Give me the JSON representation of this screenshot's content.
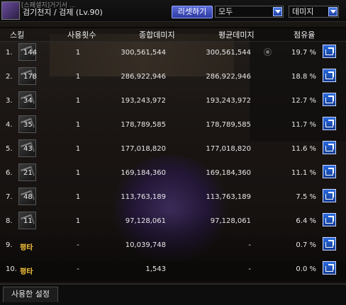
{
  "window": {
    "avatar_label": "[스페셜지]거기서 ...",
    "title": "검기천지 / 검제 (Lv.90)",
    "reset_button": "리셋하기",
    "filter_select": "모두",
    "type_select": "데미지"
  },
  "columns": {
    "skill": "스킬",
    "uses": "사용횟수",
    "total": "종합데미지",
    "average": "평균데미지",
    "share": "점유율"
  },
  "rows": [
    {
      "num": "1.",
      "id": "144",
      "uses": "1",
      "total": "300,561,544",
      "avg": "300,561,544",
      "share": "19.7 %",
      "special": false
    },
    {
      "num": "2.",
      "id": "178",
      "uses": "1",
      "total": "286,922,946",
      "avg": "286,922,946",
      "share": "18.8 %",
      "special": false
    },
    {
      "num": "3.",
      "id": "34",
      "uses": "1",
      "total": "193,243,972",
      "avg": "193,243,972",
      "share": "12.7 %",
      "special": false
    },
    {
      "num": "4.",
      "id": "35",
      "uses": "1",
      "total": "178,789,585",
      "avg": "178,789,585",
      "share": "11.7 %",
      "special": false
    },
    {
      "num": "5.",
      "id": "43",
      "uses": "1",
      "total": "177,018,820",
      "avg": "177,018,820",
      "share": "11.6 %",
      "special": false
    },
    {
      "num": "6.",
      "id": "21",
      "uses": "1",
      "total": "169,184,360",
      "avg": "169,184,360",
      "share": "11.1 %",
      "special": false
    },
    {
      "num": "7.",
      "id": "48",
      "uses": "1",
      "total": "113,763,189",
      "avg": "113,763,189",
      "share": "7.5 %",
      "special": false
    },
    {
      "num": "8.",
      "id": "11",
      "uses": "1",
      "total": "97,128,061",
      "avg": "97,128,061",
      "share": "6.4 %",
      "special": false
    },
    {
      "num": "9.",
      "id": "평타",
      "uses": "-",
      "total": "10,039,748",
      "avg": "-",
      "share": "0.7 %",
      "special": true
    },
    {
      "num": "10.",
      "id": "평타",
      "uses": "-",
      "total": "1,543",
      "avg": "-",
      "share": "0.0 %",
      "special": true
    }
  ],
  "footer": {
    "settings_tab": "사용한 설정"
  },
  "icons": {
    "share": "share-arrow-icon",
    "dropdown": "chevron-down-icon",
    "skill": "skill-icon"
  },
  "colors": {
    "accent_blue": "#2a6be0",
    "special_text": "#f4c23a"
  }
}
